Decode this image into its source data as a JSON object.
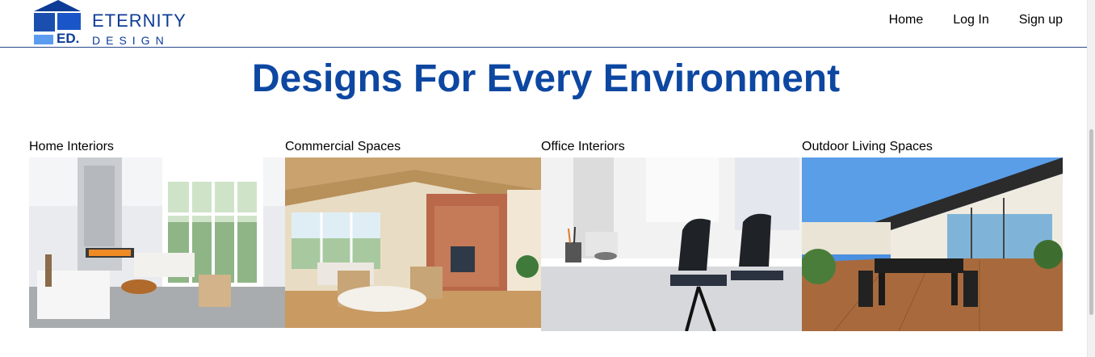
{
  "brand": {
    "monogram": "ED.",
    "name": "ETERNITY",
    "tagline": "DESIGN",
    "colors": {
      "dark": "#0d3c96",
      "mid": "#1a56c8",
      "light": "#5b9cf0"
    }
  },
  "nav": {
    "items": [
      "Home",
      "Log In",
      "Sign up"
    ]
  },
  "hero": {
    "title": "Designs For Every Environment",
    "title_color": "#0d47a1"
  },
  "categories": [
    {
      "label": "Home Interiors",
      "image": "bright white living room with tall windows, fireplace, white sofas, round wood coffee table"
    },
    {
      "label": "Commercial Spaces",
      "image": "vaulted wood ceiling room with brick fireplace, ceiling fan, wicker chairs and large windows"
    },
    {
      "label": "Office Interiors",
      "image": "modern office desk with black mesh chairs, laptop, pencil holder and headphones"
    },
    {
      "label": "Outdoor Living Spaces",
      "image": "rooftop wooden deck with black dining table and chairs, glass sliding doors, blue sky"
    }
  ]
}
